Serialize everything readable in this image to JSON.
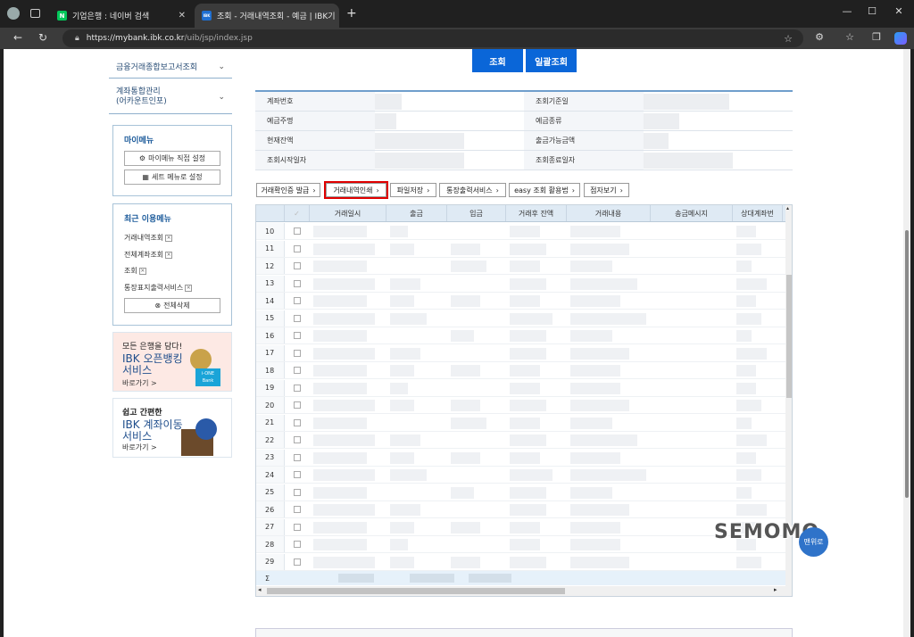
{
  "browser": {
    "tabs": [
      {
        "label": "기업은행 : 네이버 검색",
        "favicon": "N",
        "favicon_color": "#03c75a",
        "active": false
      },
      {
        "label": "조회 - 거래내역조회 - 예금 | IBK기",
        "favicon": "IBK",
        "favicon_color": "#1f6fd1",
        "active": true
      }
    ],
    "url_host": "https://mybank.ibk.co.kr",
    "url_path": "/uib/jsp/index.jsp"
  },
  "sidebar": {
    "menus": [
      {
        "label": "금융거래종합보고서조회"
      },
      {
        "label": "계좌통합관리\n(어카운트인포)"
      }
    ],
    "my_menu": {
      "title": "마이메뉴",
      "btn_direct": "마이메뉴 직접 설정",
      "btn_set": "세트 메뉴로 설정"
    },
    "recent": {
      "title": "최근 이용메뉴",
      "items": [
        "거래내역조회",
        "전체계좌조회",
        "조회",
        "통장표지출력서비스"
      ],
      "delete_all": "전체삭제"
    },
    "banner1": {
      "line1": "모든 은행을 담다!",
      "line2": "IBK 오픈뱅킹",
      "line3": "서비스",
      "link": "바로가기 >",
      "badge": "i-ONE Bank"
    },
    "banner2": {
      "line1": "쉽고 간편한",
      "line2": "IBK 계좌이동",
      "line3": "서비스",
      "link": "바로가기 >"
    }
  },
  "main": {
    "search_btn": "조회",
    "bulk_btn": "일괄조회",
    "info_labels": {
      "left": [
        "계좌번호",
        "예금주명",
        "현재잔액",
        "조회시작일자"
      ],
      "right": [
        "조회기준일",
        "예금종류",
        "출금가능금액",
        "조회종료일자"
      ]
    },
    "actions": [
      "거래확인증 발급",
      "거래내역인쇄",
      "파일저장",
      "통장출력서비스",
      "easy 조회 활용법",
      "점자보기"
    ],
    "highlighted_action": "거래내역인쇄",
    "grid": {
      "columns": [
        "거래일시",
        "출금",
        "입금",
        "거래후 잔액",
        "거래내용",
        "송금메시지",
        "상대계좌번"
      ],
      "row_numbers": [
        "10",
        "11",
        "12",
        "13",
        "14",
        "15",
        "16",
        "17",
        "18",
        "19",
        "20",
        "21",
        "22",
        "23",
        "24",
        "25",
        "26",
        "27",
        "28",
        "29"
      ],
      "sum_symbol": "Σ"
    }
  },
  "overlay": {
    "watermark": "SEMOMO",
    "top_button": "맨위로"
  },
  "colors": {
    "primary_blue": "#0a66d8",
    "highlight_red": "#e00000",
    "header_bg": "#dfeaf4"
  }
}
